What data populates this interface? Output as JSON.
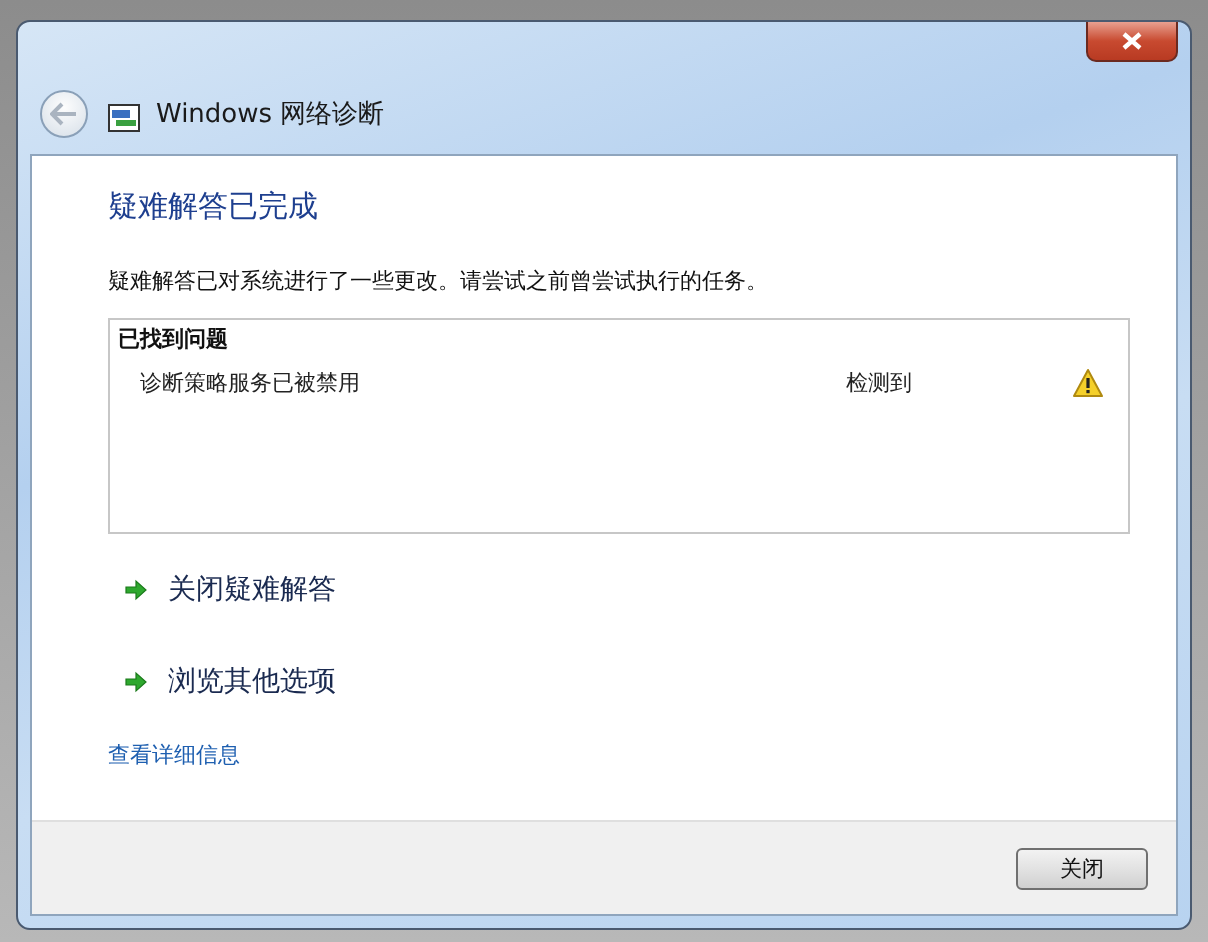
{
  "window": {
    "title": "Windows 网络诊断"
  },
  "heading": "疑难解答已完成",
  "description": "疑难解答已对系统进行了一些更改。请尝试之前曾尝试执行的任务。",
  "problems": {
    "title": "已找到问题",
    "items": [
      {
        "name": "诊断策略服务已被禁用",
        "status": "检测到",
        "kind": "warning"
      }
    ]
  },
  "actions": [
    "关闭疑难解答",
    "浏览其他选项"
  ],
  "details_link": "查看详细信息",
  "buttons": [
    "关闭"
  ]
}
